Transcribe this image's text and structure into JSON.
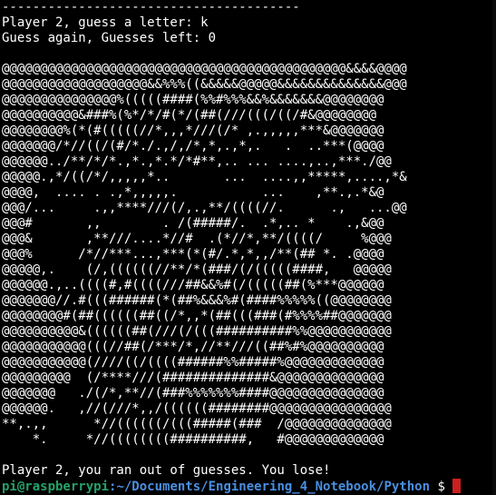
{
  "terminal": {
    "top_rule": "---------------------------------------",
    "guess_prompt": "Player 2, guess a letter: k",
    "guess_again": "Guess again, Guesses left: 0",
    "art_lines": [
      "@@@@@@@@@@@@@@@@@@@@@@@@@@@@@@@@@@@@@@@@@@@@@&&&&@@@@",
      "@@@@@@@@@@@@@@@@@@@&&%%%((&&&&&@@@@@&&&&&&&&&&&&&&@@@",
      "@@@@@@@@@@@@@@@%(((((####(%%#%%%&&%&&&&&&&@@@@@@@@",
      "@@@@@@@@@@&###%(%*/*/#(*/(##(///(((/((/#&@@@@@@@@",
      "@@@@@@@@%(*(#(((((//*,,,*///(/* ,.,,,,,***&@@@@@@@",
      "@@@@@@@/*//((/(#/*./.,/,/*,*,.,*,.   .  ..***(@@@@",
      "@@@@@@../**/*/*.,*.,*.*/*#**,.. ... ....,..,***./@@",
      "@@@@@.,*/((/*/,,,,,*..       ...  ....,,*****,....,*&",
      "@@@@,  .... . .,*,,,,,.           ...    ,**.,.*&@",
      "@@@/...     .,,****///(/,.,**/((((//.      .,   ...@@",
      "@@@#       ,,        . /(#####/.  .*,.. *    .,&@@",
      "@@@&       ,**///....*//#  .(*//*,**/((((/     %@@@",
      "@@@%      /*//***...,***(*(#/.*,*,,/**(## *. .@@@@",
      "@@@@@,.    (/,((((((//**/*(###/(/(((((####,   @@@@@",
      "@@@@@@.,..((((#,#((((///##&&%#(/(((((##(%***@@@@@@",
      "@@@@@@@//.#(((######(*(##%&&&%#(####%%%%%((@@@@@@@@",
      "@@@@@@@@#(##((((((##((/*,,*(##(((###(#%%%%##@@@@@@@",
      "@@@@@@@@@@&((((((##(///(/(((##########%%@@@@@@@@@@@",
      "@@@@@@@@@@@(((//##(/***/*,//**///((##%#%@@@@@@@@@@",
      "@@@@@@@@@@@(////((/((((######%%#####%@@@@@@@@@@@@@",
      "@@@@@@@@@  (/****///(##############&@@@@@@@@@@@@@@",
      "@@@@@@@   ./(/*,**//(###%%%%%%%####@@@@@@@@@@@@@@@",
      "@@@@@@.   ,//(///*,,/((((((########@@@@@@@@@@@@@@@@",
      "**,.,,      *//((((((/(((#####(###  /@@@@@@@@@@@@@@",
      "    *.     *//((((((((##########,   #@@@@@@@@@@@@@"
    ],
    "lose_message": "Player 2, you ran out of guesses. You lose!",
    "prompt_user": "pi@raspberrypi",
    "prompt_path": ":~/Documents/Engineering_4_Notebook/Python",
    "prompt_tail": " $ "
  },
  "colors": {
    "background": "#000000",
    "text": "#ffffff",
    "user_host": "#26a269",
    "path": "#4a8fe0",
    "cursor": "#cc1f1f"
  }
}
